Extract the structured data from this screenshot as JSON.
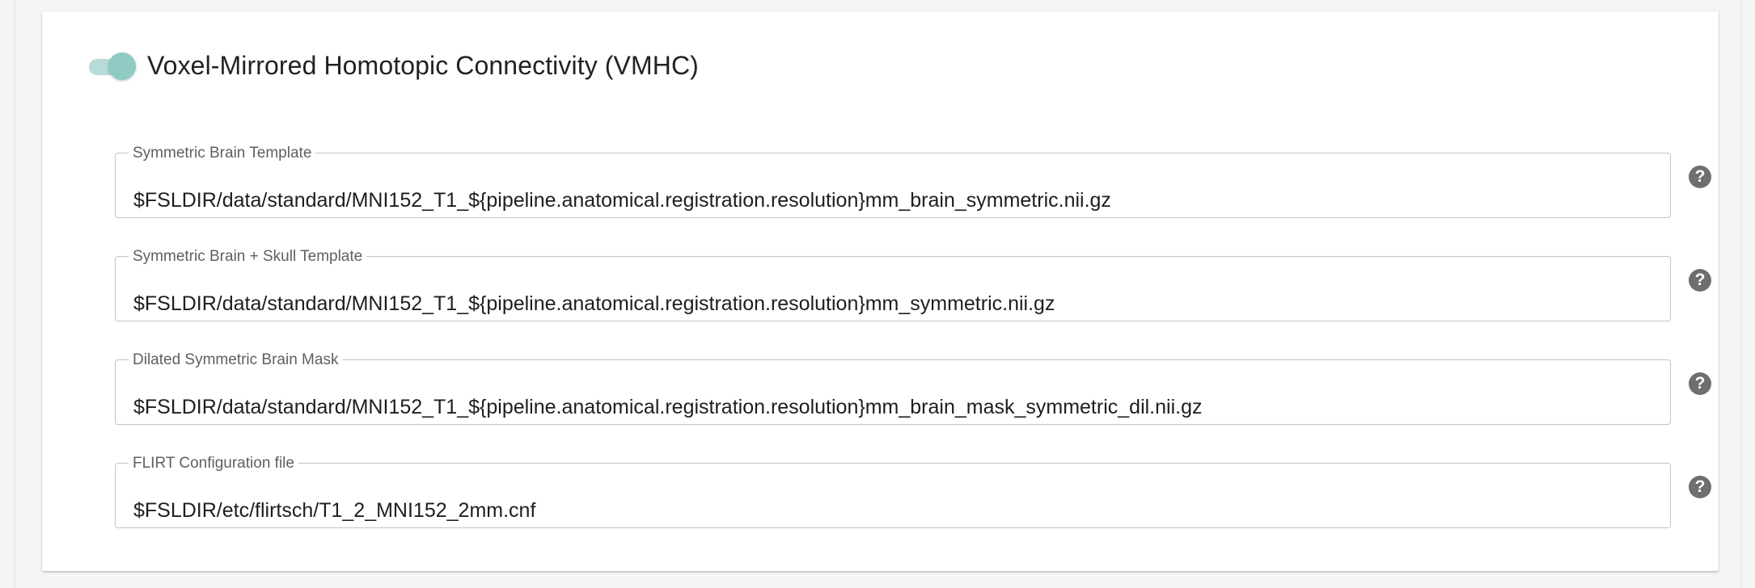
{
  "section": {
    "title": "Voxel-Mirrored Homotopic Connectivity (VMHC)",
    "enabled": true,
    "toggle_color": "#8fcac3"
  },
  "fields": [
    {
      "label": "Symmetric Brain Template",
      "value": "$FSLDIR/data/standard/MNI152_T1_${pipeline.anatomical.registration.resolution}mm_brain_symmetric.nii.gz",
      "help_icon": "question-circle-icon",
      "help_glyph": "?"
    },
    {
      "label": "Symmetric Brain + Skull Template",
      "value": "$FSLDIR/data/standard/MNI152_T1_${pipeline.anatomical.registration.resolution}mm_symmetric.nii.gz",
      "help_icon": "question-circle-icon",
      "help_glyph": "?"
    },
    {
      "label": "Dilated Symmetric Brain Mask",
      "value": "$FSLDIR/data/standard/MNI152_T1_${pipeline.anatomical.registration.resolution}mm_brain_mask_symmetric_dil.nii.gz",
      "help_icon": "question-circle-icon",
      "help_glyph": "?"
    },
    {
      "label": "FLIRT Configuration file",
      "value": "$FSLDIR/etc/flirtsch/T1_2_MNI152_2mm.cnf",
      "help_icon": "question-circle-icon",
      "help_glyph": "?"
    }
  ]
}
